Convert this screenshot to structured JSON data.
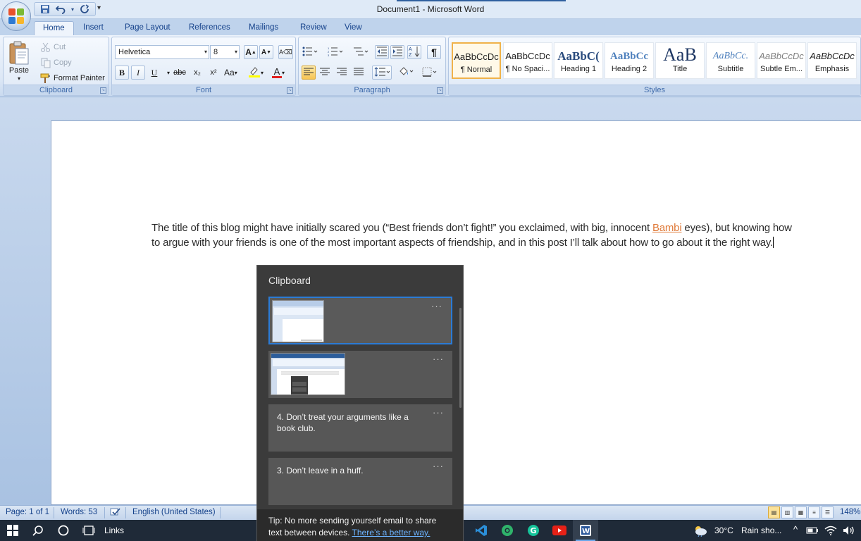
{
  "window": {
    "title": "Document1 - Microsoft Word"
  },
  "quick_access": {
    "save_icon": "save-icon",
    "undo_icon": "undo-icon",
    "redo_icon": "redo-icon",
    "customize_glyph": "▾"
  },
  "tabs": [
    {
      "label": "Home"
    },
    {
      "label": "Insert"
    },
    {
      "label": "Page Layout"
    },
    {
      "label": "References"
    },
    {
      "label": "Mailings"
    },
    {
      "label": "Review"
    },
    {
      "label": "View"
    }
  ],
  "ribbon": {
    "clipboard": {
      "label": "Clipboard",
      "paste": "Paste",
      "cut": "Cut",
      "copy": "Copy",
      "format_painter": "Format Painter"
    },
    "font": {
      "label": "Font",
      "font_name": "Helvetica",
      "font_size": "8",
      "bold": "B",
      "italic": "I",
      "underline": "U",
      "strike": "abc",
      "subscript": "x₂",
      "superscript": "x²",
      "change_case": "Aa",
      "grow": "A",
      "shrink": "A"
    },
    "paragraph": {
      "label": "Paragraph",
      "pilcrow": "¶"
    },
    "styles": {
      "label": "Styles",
      "items": [
        {
          "sample": "AaBbCcDc",
          "name": "¶ Normal"
        },
        {
          "sample": "AaBbCcDc",
          "name": "¶ No Spaci..."
        },
        {
          "sample": "AaBbC(",
          "name": "Heading 1"
        },
        {
          "sample": "AaBbCc",
          "name": "Heading 2"
        },
        {
          "sample": "AaB",
          "name": "Title"
        },
        {
          "sample": "AaBbCc.",
          "name": "Subtitle"
        },
        {
          "sample": "AaBbCcDc",
          "name": "Subtle Em..."
        },
        {
          "sample": "AaBbCcDc",
          "name": "Emphasis"
        }
      ]
    }
  },
  "document": {
    "text_before_link": "The title of this blog might have initially scared you (“Best friends don’t fight!” you exclaimed, with big, innocent ",
    "link_text": "Bambi",
    "text_after_link": " eyes), but knowing how to argue with your friends is one of the most important aspects of friendship, and in this post I’ll talk about how to go about it the right way."
  },
  "clipboard_panel": {
    "title": "Clipboard",
    "more_glyph": "···",
    "items": [
      {
        "type": "image"
      },
      {
        "type": "image"
      },
      {
        "type": "text",
        "text": "4. Don’t treat your arguments like a book club."
      },
      {
        "type": "text",
        "text": "3. Don’t leave in a huff."
      }
    ],
    "tip_text": "Tip: No more sending yourself email to share text between devices. ",
    "tip_link": "There’s a better way."
  },
  "statusbar": {
    "page": "Page: 1 of 1",
    "words": "Words: 53",
    "language": "English (United States)",
    "zoom": "148%"
  },
  "taskbar": {
    "links_label": "Links",
    "temperature": "30°C",
    "weather": "Rain sho...",
    "tray_chevron": "^"
  }
}
